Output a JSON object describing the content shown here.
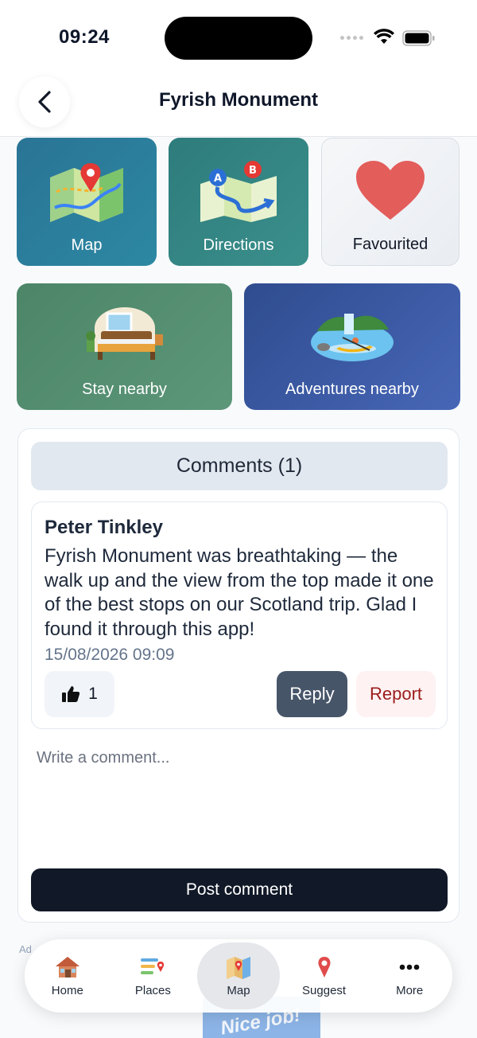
{
  "status_bar": {
    "time": "09:24"
  },
  "header": {
    "title": "Fyrish Monument"
  },
  "tiles": {
    "map": "Map",
    "directions": "Directions",
    "favourited": "Favourited",
    "stay_nearby": "Stay nearby",
    "adventures_nearby": "Adventures nearby"
  },
  "comments": {
    "header": "Comments (1)",
    "items": [
      {
        "author": "Peter Tinkley",
        "text": "Fyrish Monument was breathtaking — the walk up and the view from the top made it one of the best stops on our Scotland trip. Glad I found it through this app!",
        "timestamp": "15/08/2026 09:09",
        "likes": "1",
        "reply_label": "Reply",
        "report_label": "Report"
      }
    ],
    "input_placeholder": "Write a comment...",
    "post_label": "Post comment"
  },
  "ad": {
    "label": "Ad",
    "peek_text": "Nice job!"
  },
  "tab_bar": {
    "active": "Map",
    "items": [
      {
        "label": "Home",
        "icon": "home-icon"
      },
      {
        "label": "Places",
        "icon": "places-icon"
      },
      {
        "label": "Map",
        "icon": "map-icon"
      },
      {
        "label": "Suggest",
        "icon": "pin-icon"
      },
      {
        "label": "More",
        "icon": "more-icon"
      }
    ]
  },
  "colors": {
    "heart": "#e35d5b",
    "post_button": "#111827",
    "reply_button": "#475569",
    "report_text": "#9b1c1c"
  }
}
